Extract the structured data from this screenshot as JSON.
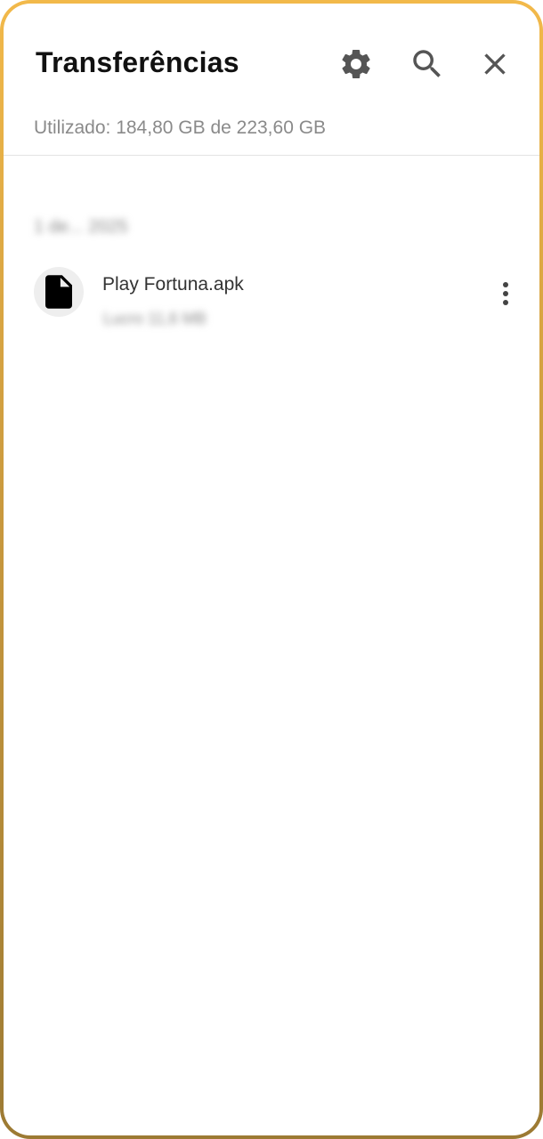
{
  "header": {
    "title": "Transferências",
    "usage_text": "Utilizado: 184,80 GB de 223,60 GB",
    "icons": [
      "gear-icon",
      "search-icon",
      "close-icon"
    ]
  },
  "downloads": {
    "groups": [
      {
        "date_label": "1 de... 2025",
        "items": [
          {
            "name": "Play Fortuna.apk",
            "meta": "Lucro 11,6 MB",
            "icon": "file-icon",
            "menu_icon": "more-vert-icon"
          }
        ]
      }
    ]
  },
  "colors": {
    "title": "#111111",
    "secondary_text": "#8a8a8a",
    "icon": "#555555",
    "frame_top": "#f2b94a",
    "frame_bottom": "#9c7a33"
  }
}
